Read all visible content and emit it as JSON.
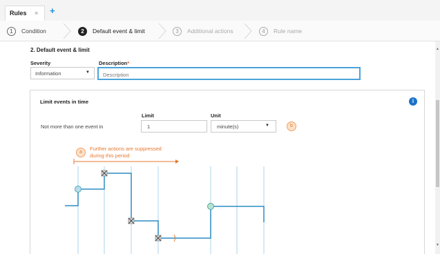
{
  "tab": {
    "label": "Rules",
    "close": "×",
    "add": "+"
  },
  "wizard": {
    "steps": [
      {
        "num": "1",
        "label": "Condition"
      },
      {
        "num": "2",
        "label": "Default event & limit"
      },
      {
        "num": "3",
        "label": "Additional actions"
      },
      {
        "num": "4",
        "label": "Rule name"
      }
    ]
  },
  "section": {
    "title": "2. Default event & limit",
    "severity_label": "Severity",
    "severity_value": "Information",
    "description_label": "Description",
    "required_mark": "*",
    "description_placeholder": "Description"
  },
  "limit_panel": {
    "title": "Limit events in time",
    "info": "i",
    "limit_label": "Limit",
    "unit_label": "Unit",
    "text": "Not more than one event in",
    "limit_value": "1",
    "unit_value": "minute(s)",
    "badge_b": "b",
    "badge_a": "a",
    "note_line1": "Further actions are suppressed",
    "note_line2": "during this period"
  },
  "colors": {
    "accent": "#1a8fdb",
    "focus": "#4aa2d9",
    "orange": "#e8772e",
    "timeline": "#2b8cc4"
  }
}
